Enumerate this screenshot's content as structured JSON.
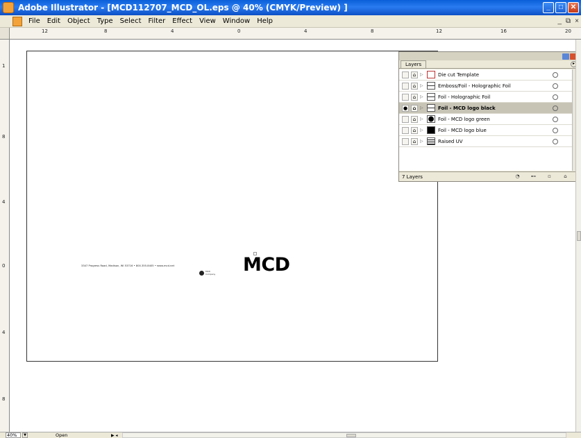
{
  "window": {
    "title": "Adobe Illustrator - [MCD112707_MCD_OL.eps @ 40% (CMYK/Preview) ]",
    "minimize": "_",
    "maximize": "□",
    "close": "✕"
  },
  "menu": {
    "items": [
      "File",
      "Edit",
      "Object",
      "Type",
      "Select",
      "Filter",
      "Effect",
      "View",
      "Window",
      "Help"
    ],
    "doc_minimize": "_",
    "doc_restore": "⧉",
    "doc_close": "×"
  },
  "ruler_top_labels": [
    "12",
    "8",
    "4",
    "0",
    "4",
    "8",
    "12",
    "16",
    "20"
  ],
  "ruler_left_labels": [
    "1",
    "8",
    "4",
    "0",
    "4",
    "8"
  ],
  "artwork": {
    "address_line": "3347 Progress Road, Madison, WI 53716  •  800.355.8405  •  www.mcd.net",
    "small_logo_text": "MCD\nCompany",
    "main_logo": "MCD"
  },
  "layers_panel": {
    "tab_label": "Layers",
    "layers": [
      {
        "name": "Die cut Template",
        "visible": false,
        "selected": false,
        "thumb": "template"
      },
      {
        "name": "Emboss/Foil - Holographic Foil",
        "visible": false,
        "selected": false,
        "thumb": "line"
      },
      {
        "name": "Foil - Holographic Foil",
        "visible": false,
        "selected": false,
        "thumb": "line"
      },
      {
        "name": "Foil - MCD logo black",
        "visible": true,
        "selected": true,
        "thumb": "line"
      },
      {
        "name": "Foil - MCD logo green",
        "visible": false,
        "selected": false,
        "thumb": "circle"
      },
      {
        "name": "Foil - MCD logo blue",
        "visible": false,
        "selected": false,
        "thumb": "black"
      },
      {
        "name": "Raised UV",
        "visible": false,
        "selected": false,
        "thumb": "lines"
      }
    ],
    "footer_count": "7 Layers"
  },
  "status": {
    "zoom": "40%",
    "status_text": "Open"
  }
}
